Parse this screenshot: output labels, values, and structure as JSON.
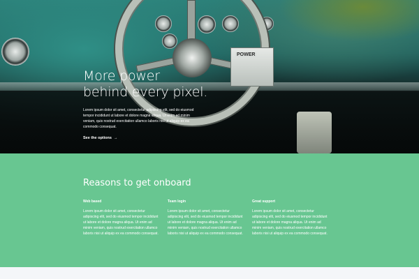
{
  "hero": {
    "title_line1": "More power",
    "title_line2": "behind every pixel.",
    "body": "Lorem ipsum dolor sit amet, consectetur adipiscing elit, sed do eiusmod tempor incididunt ut labore et dolore magna aliqua. Ut enim ad minim veniam, quis nostrud exercitation ullamco laboris nisi ut aliquip ex ea commodo consequat.",
    "link_label": "See the options",
    "link_arrow": "→",
    "badge_text": "POWER"
  },
  "reasons": {
    "title": "Reasons to get onboard",
    "features": [
      {
        "title": "Web based",
        "body": "Lorem ipsum dolor sit amet, consectetur adipiscing elit, sed do eiusmod tempor incididunt ut labore et dolore magna aliqua. Ut enim ad minim veniam, quis nostrud exercitation ullamco laboris nisi ut aliquip ex ea commodo consequat."
      },
      {
        "title": "Team login",
        "body": "Lorem ipsum dolor sit amet, consectetur adipiscing elit, sed do eiusmod tempor incididunt ut labore et dolore magna aliqua. Ut enim ad minim veniam, quis nostrud exercitation ullamco laboris nisi ut aliquip ex ea commodo consequat."
      },
      {
        "title": "Great support",
        "body": "Lorem ipsum dolor sit amet, consectetur adipiscing elit, sed do eiusmod tempor incididunt ut labore et dolore magna aliqua. Ut enim ad minim veniam, quis nostrud exercitation ullamco laboris nisi ut aliquip ex ea commodo consequat."
      }
    ]
  },
  "colors": {
    "accent_green": "#68c691",
    "footer_bg": "#f4f6f9",
    "text_white": "#ffffff"
  }
}
